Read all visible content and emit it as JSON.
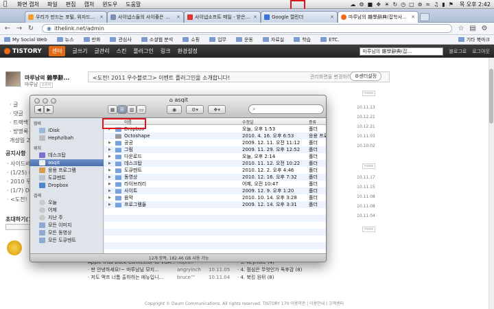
{
  "menubar": {
    "items": [
      "화면 캡처",
      "파일",
      "편집",
      "캡처",
      "윈도우",
      "도움말"
    ],
    "clock": "목 오후 2:42"
  },
  "browser": {
    "tabs": [
      {
        "label": "우리가 만드는 포털, 위자드닷컴"
      },
      {
        "label": "사이냅스들의 사이좋은 공간 InsideSynap"
      },
      {
        "label": "사이냅소프트 메일 - 받은편지함"
      },
      {
        "label": "Google 캘린더"
      },
      {
        "label": "마루남의 雜學辭典(잡학사전) :: Tistory"
      }
    ],
    "url": "ithelink.net/admin",
    "bookmarks": [
      "My Social Web",
      "뉴스",
      "만화",
      "관심사",
      "소셜웹 분석",
      "쇼핑",
      "입무",
      "운동",
      "자료실",
      "학습",
      "ETC."
    ],
    "bookmarks_other": "기타 북마크"
  },
  "tistory": {
    "logo": "TISTORY",
    "nav": [
      "센터",
      "글쓰기",
      "글관리",
      "스킨",
      "플러그인",
      "링크",
      "환경설정"
    ],
    "blog_select": "마루남의 雜學辭典(잡...",
    "right_links": [
      "블로그로",
      "로그아웃"
    ]
  },
  "page": {
    "blog_name": "마루남의 雜學辭...",
    "owner": "마루남",
    "owner_badge": "소유자",
    "left_items": [
      "글",
      "댓글",
      "트랙백",
      "방명록"
    ],
    "since": "개설일 20",
    "notice_heading": "공지사항",
    "notices": [
      "· 사이드바",
      "· (1/25) Pic",
      "· 2010 우수",
      "· (1/7) Dau",
      "· <도전! 20"
    ],
    "invite_heading": "초대하기(1)",
    "notice_box": "<도전! 2011 우수블로그> 이벤트 플러그인을 소개합니다!",
    "notice_box_right": "관리화면을 변경하려면",
    "center_setting": "센터설정",
    "dates_top": [
      "10.11.13",
      "10.12.21",
      "10.12.21",
      "10.11.03",
      "10.10.02"
    ],
    "dates_bottom": [
      "10.11.17",
      "10.11.15",
      "10.11.08",
      "10.11.08",
      "10.11.04"
    ],
    "more": "more",
    "bottom_rows": [
      {
        "left": "Apple iPad Dock Connector to VGA...",
        "author": "hapiun",
        "date": "",
        "right": "· 3. Keynote (4)"
      },
      {
        "left": "· 판 안녕하세요!~ 마루남님 모지...",
        "author": "angryinch",
        "date": "10.11.05",
        "right": "· 4. 점심은 무엇인가 독후감 (8)"
      },
      {
        "left": "· 저도 맥프 너톰 출하하는 예뉴입니...",
        "author": "bruce™",
        "date": "10.11.04",
        "right": "· 4. 북킹 원뒤 (8)"
      }
    ],
    "footer": "Copyright © Daum Communications. All rights reserved. TISTORY 170  이용약관 | 이용안내 | 고객센터"
  },
  "finder": {
    "title": "asqit",
    "search_placeholder": "",
    "sidebar": {
      "sections": [
        {
          "heading": "장비",
          "items": [
            "iDisk",
            "Hephzibah"
          ]
        },
        {
          "heading": "위치",
          "items": [
            "데스크탑",
            "asqit",
            "응용 프로그램",
            "도큐멘트",
            "Dropbox"
          ]
        },
        {
          "heading": "검색",
          "items": [
            "오늘",
            "어제",
            "지난 주",
            "모든 이미지",
            "모든 동영상",
            "모든 도큐멘트"
          ]
        }
      ],
      "selected": "asqit"
    },
    "columns": {
      "name": "이름",
      "date": "수정일",
      "kind": "종류"
    },
    "files": [
      {
        "name": "Dropbox",
        "date": "오늘, 오후 1:53",
        "kind": "폴더"
      },
      {
        "name": "Octoshape",
        "date": "2010. 4. 16. 오후 6:53",
        "kind": "응용 프로"
      },
      {
        "name": "공공",
        "date": "2009. 12. 11. 오전 11:12",
        "kind": "폴더"
      },
      {
        "name": "그림",
        "date": "2009. 11. 29. 오후 12:52",
        "kind": "폴더"
      },
      {
        "name": "다운로드",
        "date": "오늘, 오후 2:14",
        "kind": "폴더"
      },
      {
        "name": "데스크탑",
        "date": "2010. 11. 12. 오전 10:22",
        "kind": "폴더"
      },
      {
        "name": "도큐멘트",
        "date": "2010. 12. 2. 오후 4:46",
        "kind": "폴더"
      },
      {
        "name": "동영상",
        "date": "2010. 12. 16. 오후 7:32",
        "kind": "폴더"
      },
      {
        "name": "라이브러리",
        "date": "어제, 오전 10:47",
        "kind": "폴더"
      },
      {
        "name": "사이트",
        "date": "2009. 12. 9. 오후 1:20",
        "kind": "폴더"
      },
      {
        "name": "음악",
        "date": "2010. 10. 14. 오후 3:28",
        "kind": "폴더"
      },
      {
        "name": "프로그램들",
        "date": "2009. 12. 14. 오후 3:31",
        "kind": "폴더"
      }
    ],
    "status": "12개 항목, 182.46 GB 사용 가능"
  },
  "colors": {
    "accent_red": "#e0141b",
    "tistory_orange": "#e06a18",
    "selection_blue": "#4a6fae"
  },
  "icons": [
    "apple-icon",
    "dropbox-status-icon",
    "wifi-icon",
    "battery-icon",
    "volume-icon",
    "search-icon",
    "gear-icon",
    "eye-icon",
    "folder-icon",
    "home-icon",
    "star-icon",
    "wrench-icon"
  ]
}
